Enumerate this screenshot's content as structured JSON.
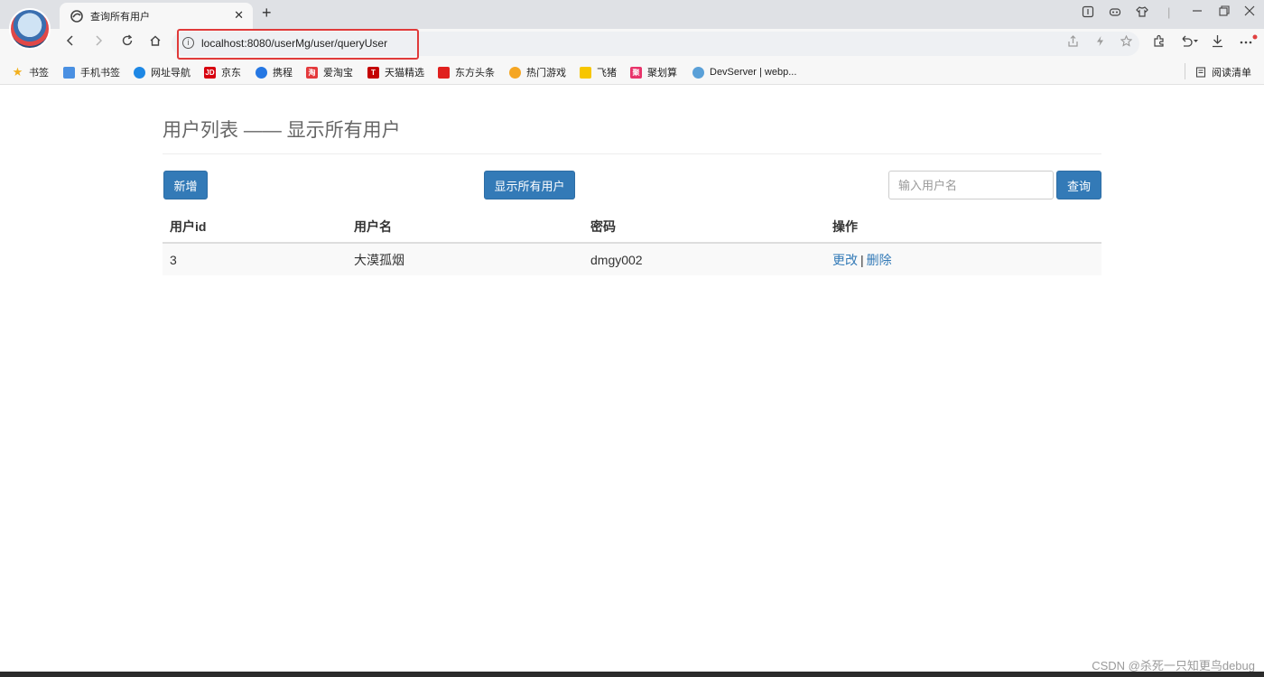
{
  "browser": {
    "tab_title": "查询所有用户",
    "tab_close": "✕",
    "new_tab": "+",
    "url": "localhost:8080/userMg/user/queryUser",
    "bookmarks": [
      {
        "label": "书签",
        "icon": "star-icon",
        "color": "#f2b01e"
      },
      {
        "label": "手机书签",
        "icon": "phone-icon",
        "color": "#4a90e2"
      },
      {
        "label": "网址导航",
        "icon": "edge-icon",
        "color": "#1e88e5"
      },
      {
        "label": "京东",
        "icon": "jd-icon",
        "color": "#d7000f"
      },
      {
        "label": "携程",
        "icon": "ctrip-icon",
        "color": "#2577e3"
      },
      {
        "label": "爱淘宝",
        "icon": "taobao-icon",
        "color": "#e4393c"
      },
      {
        "label": "天猫精选",
        "icon": "tmall-icon",
        "color": "#c40000"
      },
      {
        "label": "东方头条",
        "icon": "dongfang-icon",
        "color": "#e0201e"
      },
      {
        "label": "热门游戏",
        "icon": "game-icon",
        "color": "#f5a623"
      },
      {
        "label": "飞猪",
        "icon": "fliggy-icon",
        "color": "#f7c600"
      },
      {
        "label": "聚划算",
        "icon": "juhuasuan-icon",
        "color": "#e8336a"
      },
      {
        "label": "DevServer | webp...",
        "icon": "devserver-icon",
        "color": "#5aa0d8"
      }
    ],
    "reading_list": "阅读清单"
  },
  "page": {
    "title": "用户列表 —— 显示所有用户",
    "add_button": "新增",
    "show_all_button": "显示所有用户",
    "search_placeholder": "输入用户名",
    "search_button": "查询"
  },
  "table": {
    "headers": [
      "用户id",
      "用户名",
      "密码",
      "操作"
    ],
    "rows": [
      {
        "id": "3",
        "username": "大漠孤烟",
        "password": "dmgy002",
        "edit": "更改",
        "separator": "|",
        "delete": "删除"
      }
    ]
  },
  "watermark": "CSDN @杀死一只知更鸟debug",
  "colors": {
    "primary": "#337ab7",
    "link": "#337ab7",
    "highlight_box": "#e03a3a"
  }
}
